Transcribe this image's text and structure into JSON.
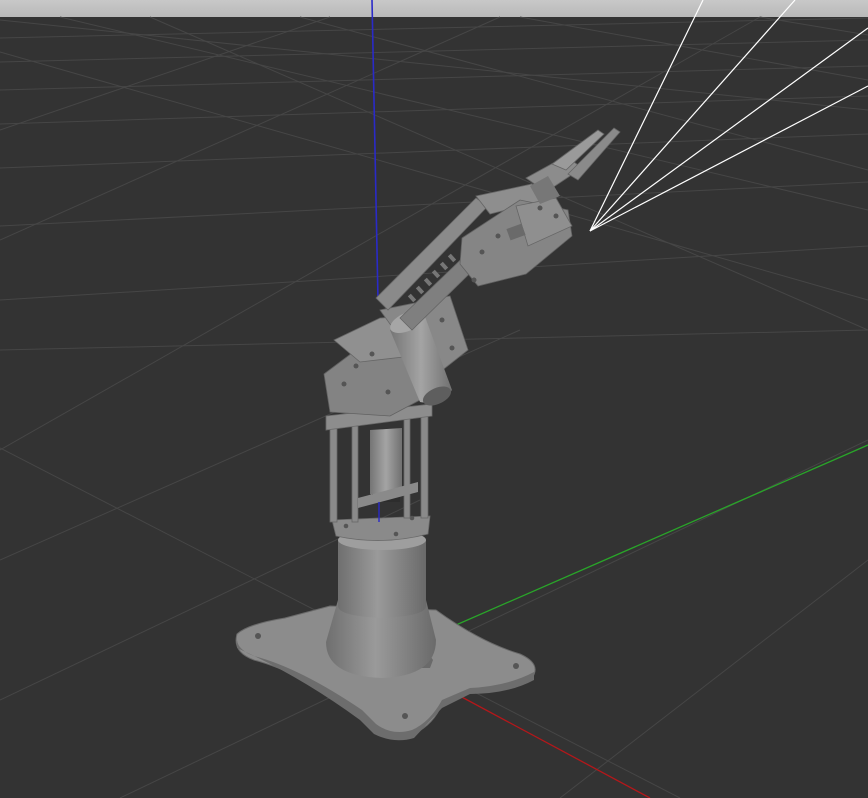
{
  "scene": {
    "background_color": "#333333",
    "horizon_color": "#c0c0c0",
    "grid_color": "#484848",
    "axis_x_color": "#b4171a",
    "axis_y_color": "#29a529",
    "axis_z_color": "#2a2ac8",
    "ray_color": "#ffffff",
    "model_color": "#8e8e8e"
  },
  "objects": {
    "ground_grid": "grid",
    "model": "robot-arm",
    "camera_rays": "camera-frustum-lines"
  }
}
